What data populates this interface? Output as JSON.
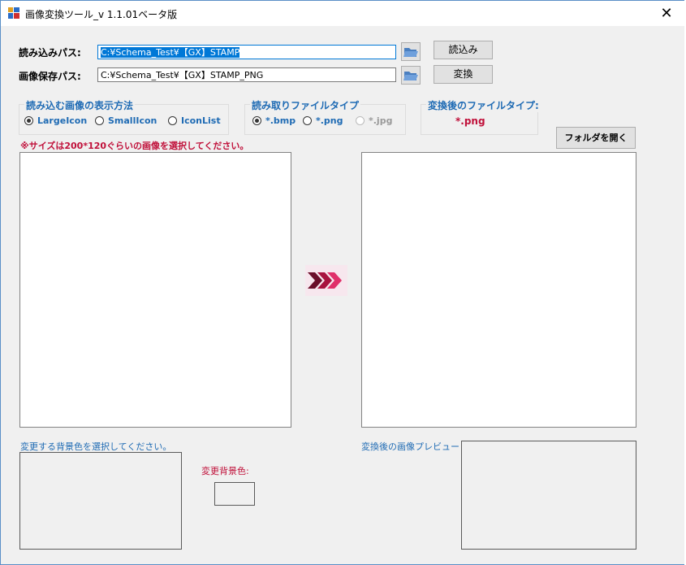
{
  "window": {
    "title": "画像変換ツール_v 1.1.01ベータ版",
    "close_glyph": "✕"
  },
  "paths": {
    "read_label": "読み込みパス:",
    "read_value": "C:¥Schema_Test¥【GX】STAMP",
    "save_label": "画像保存パス:",
    "save_value": "C:¥Schema_Test¥【GX】STAMP_PNG"
  },
  "buttons": {
    "read": "読込み",
    "convert": "変換",
    "open_folder": "フォルダを開く"
  },
  "display_group": {
    "title": "読み込む画像の表示方法",
    "options": [
      {
        "label": "LargeIcon",
        "selected": true
      },
      {
        "label": "SmallIcon",
        "selected": false
      },
      {
        "label": "IconList",
        "selected": false
      }
    ]
  },
  "filetype_group": {
    "title": "読み取りファイルタイプ",
    "options": [
      {
        "label": "*.bmp",
        "selected": true,
        "enabled": true
      },
      {
        "label": "*.png",
        "selected": false,
        "enabled": true
      },
      {
        "label": "*.jpg",
        "selected": false,
        "enabled": false
      }
    ]
  },
  "output_group": {
    "title": "変換後のファイルタイプ:",
    "value": "*.png"
  },
  "notice": "※サイズは200*120ぐらいの画像を選択してください。",
  "bottom": {
    "bg_select_label": "変更する背景色を選択してください。",
    "bg_color_label": "変更背景色:",
    "preview_label": "変換後の画像プレビュー"
  },
  "colors": {
    "accent_blue": "#1f6bb4",
    "accent_red": "#c0103a",
    "arrow": "#c8104a"
  },
  "icons": {
    "folder": "folder-open-icon",
    "arrow": "triple-chevron-right-icon",
    "app": "app-window-icon"
  }
}
